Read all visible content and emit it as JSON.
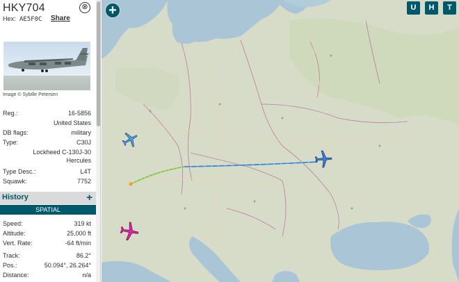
{
  "aircraft": {
    "callsign": "HKY704",
    "hex_label": "Hex:",
    "hex": "AE5F0C",
    "share_label": "Share",
    "close_label": "⊗",
    "photo_credit": "Image © Sybille Petersen"
  },
  "details": [
    {
      "key": "Reg.:",
      "value": "16-5856"
    },
    {
      "key": "",
      "value": "United States"
    },
    {
      "key": "DB flags:",
      "value": "military"
    },
    {
      "key": "Type:",
      "value": "C30J"
    },
    {
      "key": "",
      "value": "Lockheed C-130J-30",
      "value2": "Hercules"
    },
    {
      "key": "Type Desc.:",
      "value": "L4T"
    },
    {
      "key": "Squawk:",
      "value": "7752"
    }
  ],
  "history": {
    "title": "History",
    "plus": "+"
  },
  "spatial": {
    "title": "SPATIAL",
    "rows": [
      {
        "key": "Speed:",
        "value": "319 kt"
      },
      {
        "key": "Altitude:",
        "value": "25,000 ft"
      },
      {
        "key": "Vert. Rate:",
        "value": "-64 ft/min"
      },
      {
        "key": "Track:",
        "value": "86.2°"
      },
      {
        "key": "Pos.:",
        "value": "50.094°, 26.264°"
      },
      {
        "key": "Distance:",
        "value": "n/a"
      }
    ]
  },
  "map": {
    "zoom_label": "+",
    "buttons": [
      "U",
      "H",
      "T"
    ],
    "colors": {
      "accent": "#00596b",
      "selected_plane": "#3b7ddd",
      "other_plane_blue": "#4aa3df",
      "other_plane_pink": "#e0269b",
      "water": "#aac6d6",
      "land": "#d7dcc8"
    }
  }
}
